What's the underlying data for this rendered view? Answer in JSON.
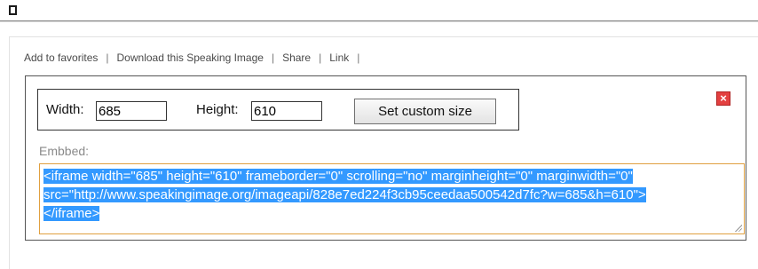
{
  "actions": {
    "add_favorites": "Add to favorites",
    "download": "Download this Speaking Image",
    "share": "Share",
    "link": "Link",
    "separator": "|"
  },
  "size_form": {
    "width_label": "Width:",
    "width_value": "685",
    "height_label": "Height:",
    "height_value": "610",
    "button_label": "Set custom size"
  },
  "close_icon_glyph": "×",
  "embed": {
    "label": "Embbed:",
    "line1": "<iframe width=\"685\" height=\"610\" frameborder=\"0\" scrolling=\"no\" marginheight=\"0\" marginwidth=\"0\"",
    "line2": "src=\"http://www.speakingimage.org/imageapi/828e7ed224f3cb95ceedaa500542d7fc?w=685&h=610\">",
    "line3": "</iframe>"
  },
  "colors": {
    "selection": "#3399ff",
    "close_red": "#e34040",
    "focus_border": "#e0a040"
  }
}
